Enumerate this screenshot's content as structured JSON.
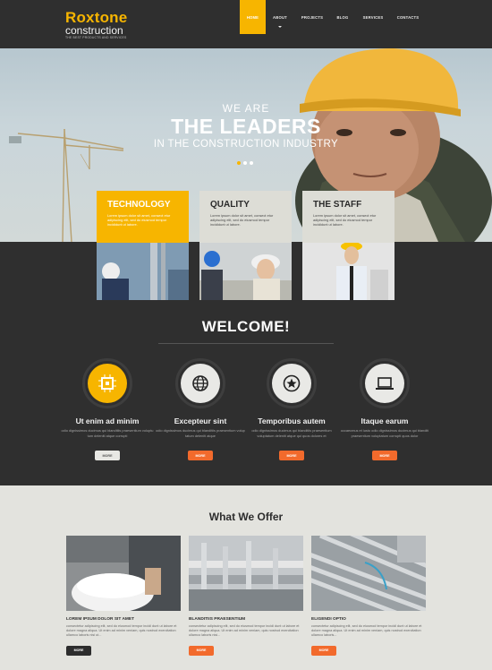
{
  "header": {
    "logo_title": "Roxtone",
    "logo_sub": "construction",
    "logo_tag": "THE BEST PRODUCTS AND SERVICES",
    "nav": [
      "HOME",
      "ABOUT",
      "PROJECTS",
      "BLOG",
      "SERVICES",
      "CONTACTS"
    ],
    "active_nav": "HOME"
  },
  "hero": {
    "line1": "WE ARE",
    "line2": "THE LEADERS",
    "line3": "IN THE CONSTRUCTION INDUSTRY",
    "active_slide": 1,
    "slides": 3
  },
  "cards": [
    {
      "title": "TECHNOLOGY",
      "text": "Lorem ipsum dolor sit amet, consect etur adipiscing elit, sed do eiusmod tempor incididunt ut labore."
    },
    {
      "title": "QUALITY",
      "text": "Lorem ipsum dolor sit amet, consect etur adipiscing elit, sed do eiusmod tempor incididunt ut labore."
    },
    {
      "title": "THE STAFF",
      "text": "Lorem ipsum dolor sit amet, consect etur adipiscing elit, sed do eiusmod tempor incididunt ut labore."
    }
  ],
  "welcome": {
    "title": "WELCOME!",
    "features": [
      {
        "title": "Ut enim ad minim",
        "text": "odio dignissimos ducimus qui blanditiis praesentium voluptu tum deleniti atque corrupti",
        "button": "MORE",
        "icon": "chip-icon"
      },
      {
        "title": "Excepteur sint",
        "text": "odio dignissimos ducimus qui blanditiis praesentium volup tatum deleniti atque",
        "button": "MORE",
        "icon": "globe-icon"
      },
      {
        "title": "Temporibus autem",
        "text": "odio dignissimos ducimus qui blanditiis praesentium voluptatum deleniti atque qui quos dolores et",
        "button": "MORE",
        "icon": "star-icon"
      },
      {
        "title": "Itaque earum",
        "text": "occaecmus et iusto odio dignissimos ducimus qui blanditi praesentium voluptatum corrupti quos dolor",
        "button": "MORE",
        "icon": "laptop-icon"
      }
    ]
  },
  "offer": {
    "title": "What We Offer",
    "items": [
      {
        "title": "LOREM IPSUM DOLOR SIT AMET",
        "text": "consectetur adipiscing elit, sed do eiusmod tempor incidi dunt ut labore et dolore magna aliqua. Ut enim ad minim veniam, quis nostrud exercitation ullamco laboris nisi ut...",
        "button": "MORE"
      },
      {
        "title": "BLANDITIIS PRAESENTIUM",
        "text": "consectetur adipiscing elit, sed do eiusmod tempor incidi dunt ut labore et dolore magna aliqua. Ut enim ad minim veniam, quis nostrud exercitation ullamco laboris nisi...",
        "button": "MORE"
      },
      {
        "title": "ELIGENDI OPTIO",
        "text": "consectetur adipiscing elit, sed do eiusmod tempor incidi dunt ut labore et dolore magna aliqua. Ut enim ad minim veniam, quis nostrud exercitation ullamco laboris...",
        "button": "MORE"
      }
    ]
  },
  "colors": {
    "accent": "#f7b500",
    "button": "#f26a2c",
    "dark": "#2f2f2f",
    "light": "#e3e3de"
  }
}
